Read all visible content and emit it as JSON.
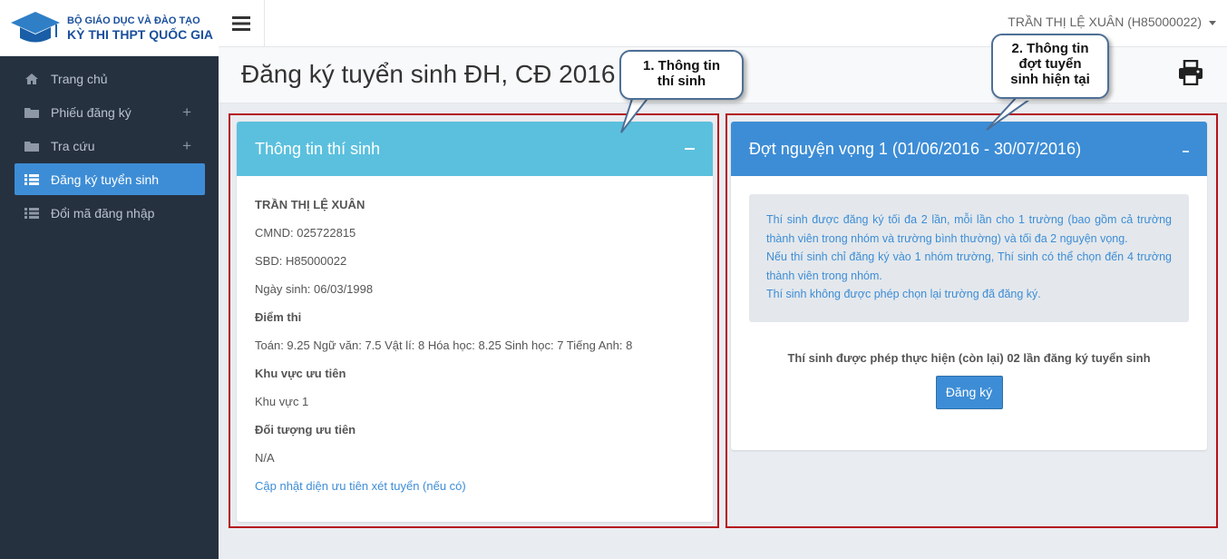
{
  "logo": {
    "line1": "BỘ GIÁO DỤC VÀ ĐÀO TẠO",
    "line2": "KỲ THI THPT QUỐC GIA"
  },
  "sidebar": {
    "items": [
      {
        "label": "Trang chủ",
        "icon": "home-icon"
      },
      {
        "label": "Phiếu đăng ký",
        "icon": "folder-icon",
        "expand": "+"
      },
      {
        "label": "Tra cứu",
        "icon": "folder-icon",
        "expand": "+"
      },
      {
        "label": "Đăng ký tuyển sinh",
        "icon": "list-icon",
        "active": true
      },
      {
        "label": "Đổi mã đăng nhập",
        "icon": "list-icon"
      }
    ]
  },
  "topbar": {
    "user": "TRẦN THỊ LỆ XUÂN (H85000022)"
  },
  "page": {
    "title": "Đăng ký tuyển sinh ĐH, CĐ 2016"
  },
  "callouts": {
    "c1": [
      "1. Thông tin",
      "thí sinh"
    ],
    "c2": [
      "2. Thông tin",
      "đợt tuyển",
      "sinh hiện tại"
    ]
  },
  "student_panel": {
    "title": "Thông tin thí sinh",
    "name": "TRẦN THỊ LỆ XUÂN",
    "cmnd": "CMND: 025722815",
    "sbd": "SBD: H85000022",
    "dob": "Ngày sinh: 06/03/1998",
    "scores_heading": "Điểm thi",
    "scores": "Toán: 9.25 Ngữ văn: 7.5 Vật lí: 8 Hóa học: 8.25 Sinh học: 7 Tiếng Anh: 8",
    "region_heading": "Khu vực ưu tiên",
    "region": "Khu vực 1",
    "target_heading": "Đối tượng ưu tiên",
    "target": "N/A",
    "update_link": "Cập nhật diện ưu tiên xét tuyển (nếu có)"
  },
  "round_panel": {
    "title": "Đợt nguyện vọng 1 (01/06/2016 - 30/07/2016)",
    "notice": [
      "Thí sinh được đăng ký tối đa 2 lần, mỗi lần cho 1 trường (bao gồm cả trường thành viên trong nhóm và trường bình thường) và tối đa 2 nguyện vọng.",
      "Nếu thí sinh chỉ đăng ký vào 1 nhóm trường, Thí sinh có thể chọn đến 4 trường thành viên trong nhóm.",
      "Thí sinh không được phép chọn lại trường đã đăng ký."
    ],
    "quota": "Thí sinh được phép thực hiện (còn lại) 02 lần đăng ký tuyển sinh",
    "button": "Đăng ký"
  },
  "colors": {
    "sidebar": "#263140",
    "accent": "#3d8dd6",
    "student_head": "#5bc0de",
    "round_head": "#3d8dd6",
    "highlight": "#b5121b"
  }
}
